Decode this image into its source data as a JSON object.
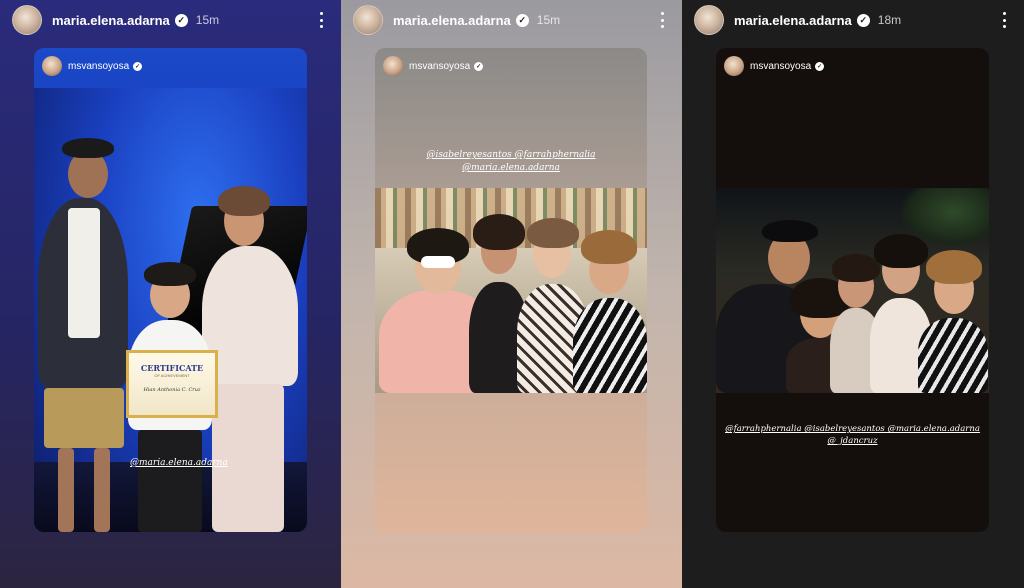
{
  "stories": [
    {
      "username": "maria.elena.adarna",
      "time": "15m",
      "shared_username": "msvansoyosa",
      "tags": [
        "@maria.elena.adarna"
      ],
      "certificate": {
        "title": "CERTIFICATE",
        "subtitle": "OF ACHIEVEMENT",
        "name": "Hian Anthonia C. Cruz"
      }
    },
    {
      "username": "maria.elena.adarna",
      "time": "15m",
      "shared_username": "msvansoyosa",
      "tags": [
        "@isabelreyesantos @farrahphernalia",
        "@maria.elena.adarna"
      ]
    },
    {
      "username": "maria.elena.adarna",
      "time": "18m",
      "shared_username": "msvansoyosa",
      "tags": [
        "@farrahphernalia @isabelreyesantos @maria.elena.adarna",
        "@_jdancruz"
      ]
    }
  ],
  "icons": {
    "verified": "verified-badge-icon",
    "more": "more-options-icon"
  }
}
